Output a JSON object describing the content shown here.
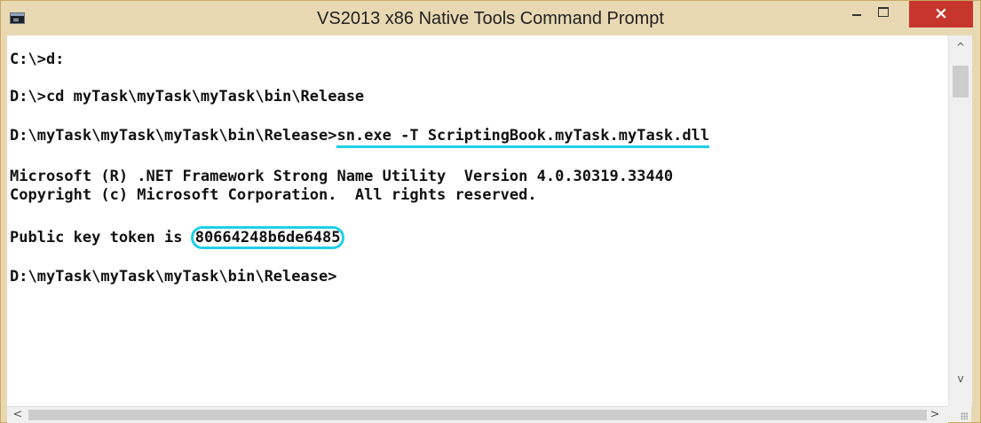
{
  "window": {
    "title": "VS2013 x86 Native Tools Command Prompt",
    "icon": "console-app-icon",
    "controls": {
      "minimize": "minimize-icon",
      "maximize": "maximize-icon",
      "close": "×"
    }
  },
  "console": {
    "lines": [
      "C:\\>d:",
      "D:\\>cd myTask\\myTask\\myTask\\bin\\Release",
      "Microsoft (R) .NET Framework Strong Name Utility  Version 4.0.30319.33440",
      "Copyright (c) Microsoft Corporation.  All rights reserved.",
      "D:\\myTask\\myTask\\myTask\\bin\\Release>"
    ],
    "command_prompt": "D:\\myTask\\myTask\\myTask\\bin\\Release>",
    "command": "sn.exe -T ScriptingBook.myTask.myTask.dll",
    "token_label": "Public key token is ",
    "token_value": "80664248b6de6485"
  },
  "scrollbars": {
    "up": "^",
    "down": "v",
    "left": "<",
    "right": ">"
  },
  "colors": {
    "highlight": "#1fd0e6",
    "close_button": "#c7362c",
    "frame": "#e8d8b2"
  }
}
